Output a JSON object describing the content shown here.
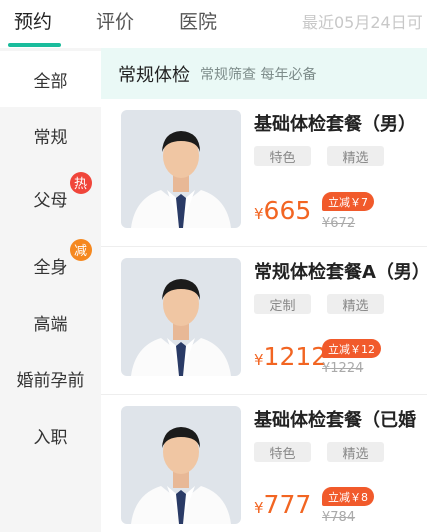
{
  "top_tabs": [
    {
      "label": "预约",
      "active": true
    },
    {
      "label": "评价",
      "active": false
    },
    {
      "label": "医院",
      "active": false
    }
  ],
  "recent_note": "最近05月24日可",
  "sidebar": {
    "items": [
      {
        "label": "全部",
        "active": true
      },
      {
        "label": "常规"
      },
      {
        "label": "父母",
        "badge": "热",
        "badge_color": "#f0453a"
      },
      {
        "label": "全身",
        "badge": "减",
        "badge_color": "#f5881f"
      },
      {
        "label": "高端"
      },
      {
        "label": "婚前孕前"
      },
      {
        "label": "入职"
      }
    ]
  },
  "section": {
    "title": "常规体检",
    "subtitle": "常规筛查 每年必备"
  },
  "packages": [
    {
      "title": "基础体检套餐（男）",
      "tags": [
        "特色",
        "精选"
      ],
      "currency": "¥",
      "price": "665",
      "discount": "立减￥7",
      "original_price": "¥672"
    },
    {
      "title": "常规体检套餐A（男）",
      "tags": [
        "定制",
        "精选"
      ],
      "currency": "¥",
      "price": "1212",
      "discount": "立减￥12",
      "original_price": "¥1224"
    },
    {
      "title": "基础体检套餐（已婚",
      "tags": [
        "特色",
        "精选"
      ],
      "currency": "¥",
      "price": "777",
      "discount": "立减￥8",
      "original_price": "¥784"
    }
  ],
  "colors": {
    "accent": "#1abc9c",
    "price": "#f26522",
    "discount_bg": "#f15a2b",
    "section_bg": "#eaf9f6",
    "sidebar_bg": "#f5f5f5"
  }
}
